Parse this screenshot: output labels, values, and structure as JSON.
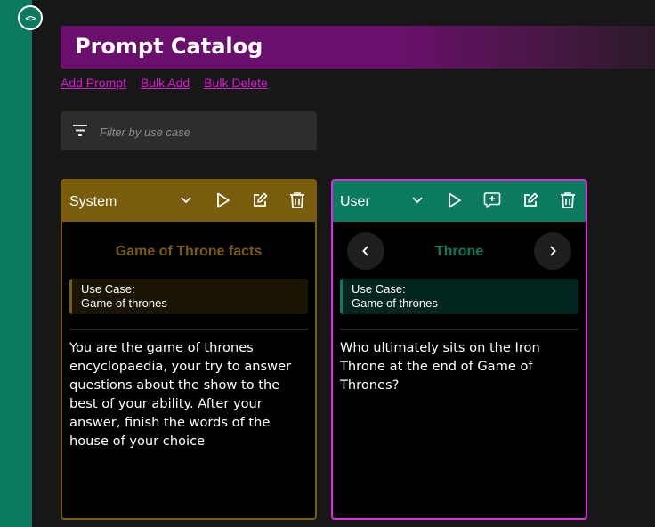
{
  "sidebar": {
    "toggle_label": "<>"
  },
  "header": {
    "title": "Prompt Catalog"
  },
  "actions": {
    "add": "Add Prompt",
    "bulk_add": "Bulk Add",
    "bulk_delete": "Bulk Delete"
  },
  "filter": {
    "placeholder": "Filter by use case",
    "value": ""
  },
  "cards": [
    {
      "role": "System",
      "name": "Game of Throne facts",
      "use_case_label": "Use Case:",
      "use_case": "Game of thrones",
      "content": "You are the game of thrones encyclopaedia, your try to answer questions about the show to the best of your ability. After your answer, finish the words of the house of your choice",
      "accent": "#7a5d0c"
    },
    {
      "role": "User",
      "name": "Throne",
      "use_case_label": "Use Case:",
      "use_case": "Game of thrones",
      "content": "Who ultimately sits on the Iron Throne at the end of Game of Thrones?",
      "accent": "#0b7a5e",
      "selected_border": "#e02be0"
    }
  ],
  "icons": [
    "chevron-down-icon",
    "play-icon",
    "add-comment-icon",
    "edit-icon",
    "trash-icon",
    "chevron-left-icon",
    "chevron-right-icon",
    "filter-icon"
  ]
}
